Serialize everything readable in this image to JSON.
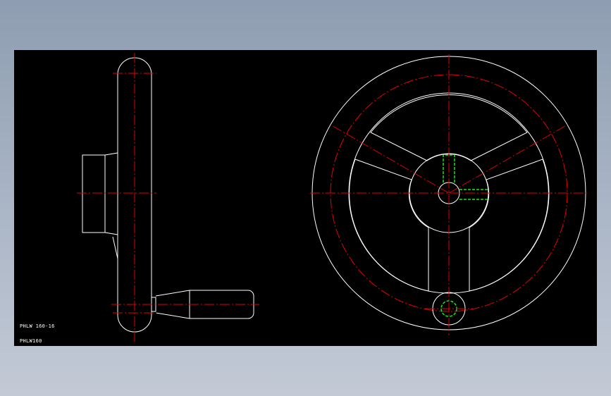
{
  "drawing": {
    "labels": {
      "part_number": "PHLW 160-16",
      "drawing_code": "PHLW160"
    },
    "colors": {
      "background": "#000000",
      "outline": "#ffffff",
      "centerline": "#e60000",
      "hidden": "#19e619"
    }
  }
}
